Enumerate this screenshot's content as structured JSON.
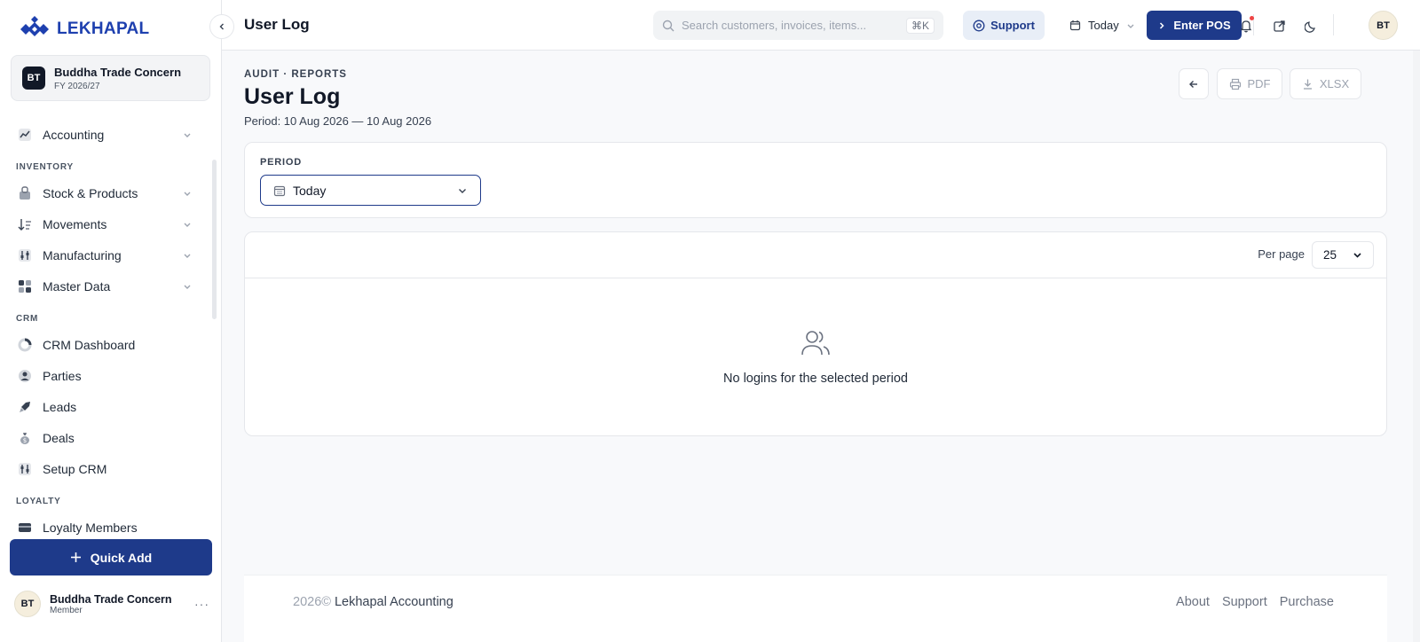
{
  "brand": {
    "name": "LEKHAPAL"
  },
  "org": {
    "initials": "BT",
    "name": "Buddha Trade Concern",
    "fy": "FY 2026/27"
  },
  "nav": {
    "accounting": "Accounting",
    "inventory_section": "INVENTORY",
    "stock": "Stock & Products",
    "movements": "Movements",
    "manufacturing": "Manufacturing",
    "master_data": "Master Data",
    "crm_section": "CRM",
    "crm_dashboard": "CRM Dashboard",
    "parties": "Parties",
    "leads": "Leads",
    "deals": "Deals",
    "setup_crm": "Setup CRM",
    "loyalty_section": "LOYALTY",
    "loyalty_members": "Loyalty Members"
  },
  "quick_add": "Quick Add",
  "user": {
    "initials": "BT",
    "name": "Buddha Trade Concern",
    "role": "Member"
  },
  "topbar": {
    "title": "User Log",
    "search_placeholder": "Search customers, invoices, items...",
    "shortcut": "⌘K",
    "support": "Support",
    "date_range": "Today",
    "enter_pos": "Enter POS",
    "avatar": "BT"
  },
  "page": {
    "eyebrow": "AUDIT · REPORTS",
    "title": "User Log",
    "period": "Period: 10 Aug 2026 — 10 Aug 2026",
    "pdf": "PDF",
    "xlsx": "XLSX"
  },
  "filter": {
    "label": "PERIOD",
    "value": "Today"
  },
  "table": {
    "per_page_label": "Per page",
    "per_page_value": "25",
    "empty_text": "No logins for the selected period"
  },
  "footer": {
    "copyright": "2026©",
    "brand": "Lekhapal Accounting",
    "about": "About",
    "support": "Support",
    "purchase": "Purchase"
  },
  "colors": {
    "primary": "#1e3a8a",
    "brand": "#1e40af",
    "notification": "#ef4444"
  }
}
